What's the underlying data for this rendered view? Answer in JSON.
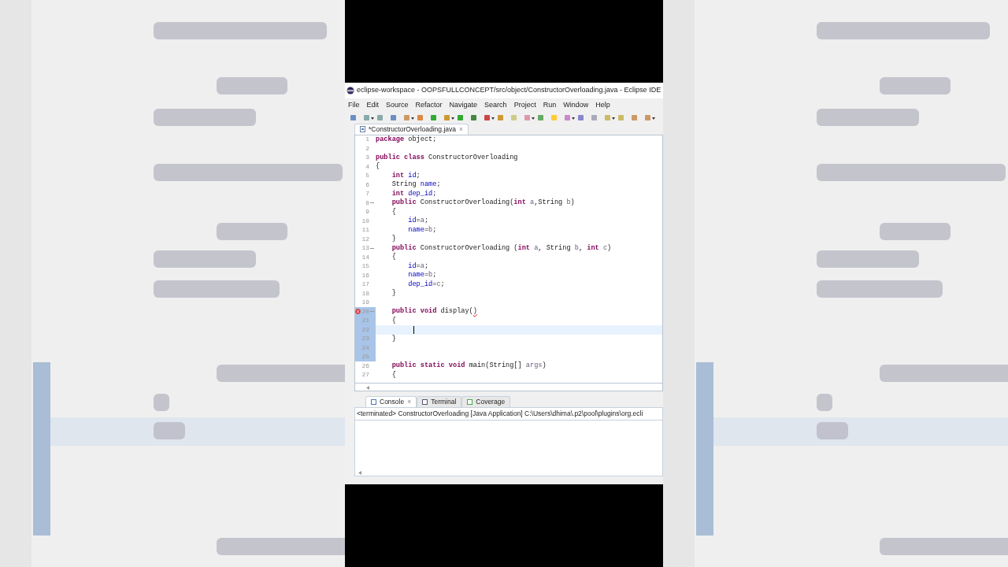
{
  "window": {
    "title": "eclipse-workspace - OOPSFULLCONCEPT/src/object/ConstructorOverloading.java - Eclipse IDE"
  },
  "menu": [
    "File",
    "Edit",
    "Source",
    "Refactor",
    "Navigate",
    "Search",
    "Project",
    "Run",
    "Window",
    "Help"
  ],
  "editor_tab": {
    "label": "*ConstructorOverloading.java",
    "close": "×",
    "selected": true
  },
  "code_lines": [
    {
      "number": "1",
      "tokens": [
        {
          "text": "package",
          "kind": "keyword"
        },
        {
          "text": " object;",
          "kind": "plain"
        }
      ]
    },
    {
      "number": "2"
    },
    {
      "number": "3",
      "tokens": [
        {
          "text": "public class",
          "kind": "keyword"
        },
        {
          "text": " ConstructorOverloading",
          "kind": "plain"
        }
      ]
    },
    {
      "number": "4",
      "tokens": [
        {
          "text": "{",
          "kind": "plain"
        }
      ]
    },
    {
      "number": "5",
      "tokens": [
        {
          "text": "    int",
          "kind": "keyword"
        },
        {
          "text": " id",
          "kind": "field"
        },
        {
          "text": ";",
          "kind": "plain"
        }
      ]
    },
    {
      "number": "6",
      "tokens": [
        {
          "text": "    String",
          "kind": "plain"
        },
        {
          "text": " name",
          "kind": "field"
        },
        {
          "text": ";",
          "kind": "plain"
        }
      ]
    },
    {
      "number": "7",
      "tokens": [
        {
          "text": "    int",
          "kind": "keyword"
        },
        {
          "text": " dep_id",
          "kind": "field"
        },
        {
          "text": ";",
          "kind": "plain"
        }
      ]
    },
    {
      "number": "8",
      "fold": true,
      "tokens": [
        {
          "text": "    public",
          "kind": "keyword"
        },
        {
          "text": " ConstructorOverloading(",
          "kind": "plain"
        },
        {
          "text": "int",
          "kind": "keyword"
        },
        {
          "text": " a",
          "kind": "param"
        },
        {
          "text": ",String",
          "kind": "plain"
        },
        {
          "text": " b",
          "kind": "param"
        },
        {
          "text": ")",
          "kind": "plain"
        }
      ]
    },
    {
      "number": "9",
      "tokens": [
        {
          "text": "    {",
          "kind": "plain"
        }
      ]
    },
    {
      "number": "10",
      "tokens": [
        {
          "text": "        id",
          "kind": "field"
        },
        {
          "text": "=",
          "kind": "plain"
        },
        {
          "text": "a",
          "kind": "param"
        },
        {
          "text": ";",
          "kind": "plain"
        }
      ]
    },
    {
      "number": "11",
      "tokens": [
        {
          "text": "        name",
          "kind": "field"
        },
        {
          "text": "=",
          "kind": "plain"
        },
        {
          "text": "b",
          "kind": "param"
        },
        {
          "text": ";",
          "kind": "plain"
        }
      ]
    },
    {
      "number": "12",
      "tokens": [
        {
          "text": "    }",
          "kind": "plain"
        }
      ]
    },
    {
      "number": "13",
      "fold": true,
      "tokens": [
        {
          "text": "    public",
          "kind": "keyword"
        },
        {
          "text": " ConstructorOverloading (",
          "kind": "plain"
        },
        {
          "text": "int",
          "kind": "keyword"
        },
        {
          "text": " a",
          "kind": "param"
        },
        {
          "text": ", String",
          "kind": "plain"
        },
        {
          "text": " b",
          "kind": "param"
        },
        {
          "text": ", ",
          "kind": "plain"
        },
        {
          "text": "int",
          "kind": "keyword"
        },
        {
          "text": " c",
          "kind": "param"
        },
        {
          "text": ")",
          "kind": "plain"
        }
      ]
    },
    {
      "number": "14",
      "tokens": [
        {
          "text": "    {",
          "kind": "plain"
        }
      ]
    },
    {
      "number": "15",
      "tokens": [
        {
          "text": "        id",
          "kind": "field"
        },
        {
          "text": "=",
          "kind": "plain"
        },
        {
          "text": "a",
          "kind": "param"
        },
        {
          "text": ";",
          "kind": "plain"
        }
      ]
    },
    {
      "number": "16",
      "tokens": [
        {
          "text": "        name",
          "kind": "field"
        },
        {
          "text": "=",
          "kind": "plain"
        },
        {
          "text": "b",
          "kind": "param"
        },
        {
          "text": ";",
          "kind": "plain"
        }
      ]
    },
    {
      "number": "17",
      "tokens": [
        {
          "text": "        dep_id",
          "kind": "field"
        },
        {
          "text": "=",
          "kind": "plain"
        },
        {
          "text": "c",
          "kind": "param"
        },
        {
          "text": ";",
          "kind": "plain"
        }
      ]
    },
    {
      "number": "18",
      "tokens": [
        {
          "text": "    }",
          "kind": "plain"
        }
      ]
    },
    {
      "number": "19"
    },
    {
      "number": "20",
      "fold": true,
      "error": true,
      "changed": true,
      "tokens": [
        {
          "text": "    public void",
          "kind": "keyword"
        },
        {
          "text": " display(",
          "kind": "plain"
        },
        {
          "text": ")",
          "kind": "error"
        }
      ]
    },
    {
      "number": "21",
      "changed": true,
      "tokens": [
        {
          "text": "    {",
          "kind": "plain"
        }
      ]
    },
    {
      "number": "22",
      "changed": true,
      "current": true
    },
    {
      "number": "23",
      "changed": true,
      "tokens": [
        {
          "text": "    }",
          "kind": "plain"
        }
      ]
    },
    {
      "number": "24",
      "changed": true
    },
    {
      "number": "25",
      "changed": true
    },
    {
      "number": "26",
      "tokens": [
        {
          "text": "    public static void",
          "kind": "keyword"
        },
        {
          "text": " main(String[]",
          "kind": "plain"
        },
        {
          "text": " args",
          "kind": "param"
        },
        {
          "text": ")",
          "kind": "plain"
        }
      ]
    },
    {
      "number": "27",
      "tokens": [
        {
          "text": "    {",
          "kind": "plain"
        }
      ]
    }
  ],
  "console_tabs": [
    {
      "label": "Console",
      "close": "×",
      "selected": true
    },
    {
      "label": "Terminal",
      "selected": false
    },
    {
      "label": "Coverage",
      "selected": false
    }
  ],
  "console_status": "<terminated> ConstructorOverloading [Java Application] C:\\Users\\dhima\\.p2\\pool\\plugins\\org.ecli"
}
